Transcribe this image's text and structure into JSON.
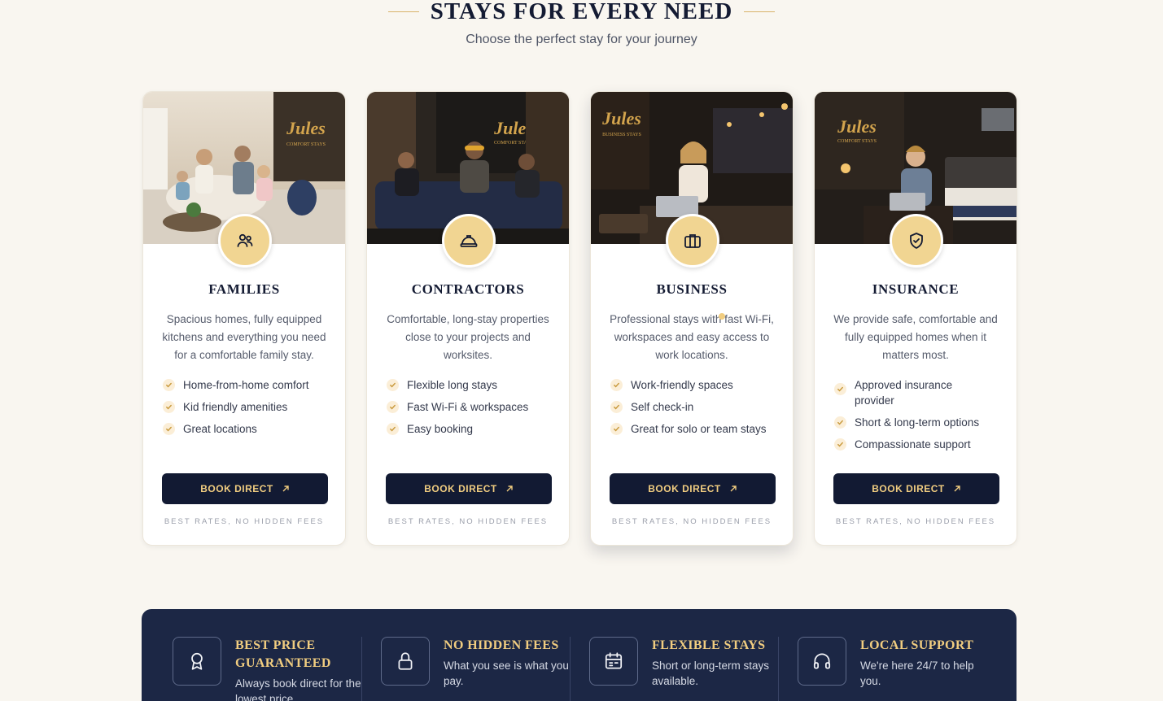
{
  "header": {
    "title": "STAYS FOR EVERY NEED",
    "subtitle": "Choose the perfect stay for your journey"
  },
  "cards": [
    {
      "icon": "family-icon",
      "title": "FAMILIES",
      "description": "Spacious homes, fully equipped kitchens and everything you need for a comfortable family stay.",
      "features": [
        "Home-from-home comfort",
        "Kid friendly amenities",
        "Great locations"
      ],
      "button": "BOOK DIRECT",
      "note": "BEST RATES, NO HIDDEN FEES"
    },
    {
      "icon": "hard-hat-icon",
      "title": "CONTRACTORS",
      "description": "Comfortable, long-stay properties close to your projects and worksites.",
      "features": [
        "Flexible long stays",
        "Fast Wi-Fi & workspaces",
        "Easy booking"
      ],
      "button": "BOOK DIRECT",
      "note": "BEST RATES, NO HIDDEN FEES"
    },
    {
      "icon": "briefcase-icon",
      "title": "BUSINESS",
      "description": "Professional stays with fast Wi-Fi, workspaces and easy access to work locations.",
      "features": [
        "Work-friendly spaces",
        "Self check-in",
        "Great for solo or team stays"
      ],
      "button": "BOOK DIRECT",
      "note": "BEST RATES, NO HIDDEN FEES"
    },
    {
      "icon": "shield-check-icon",
      "title": "INSURANCE",
      "description": "We provide safe, comfortable and fully equipped homes when it matters most.",
      "features": [
        "Approved insurance provider",
        "Short & long-term options",
        "Compassionate support"
      ],
      "button": "BOOK DIRECT",
      "note": "BEST RATES, NO HIDDEN FEES"
    }
  ],
  "perks": [
    {
      "icon": "award-icon",
      "title": "BEST PRICE GUARANTEED",
      "description": "Always book direct for the lowest price."
    },
    {
      "icon": "lock-icon",
      "title": "NO HIDDEN FEES",
      "description": "What you see is what you pay."
    },
    {
      "icon": "calendar-icon",
      "title": "FLEXIBLE STAYS",
      "description": "Short or long-term stays available."
    },
    {
      "icon": "headphones-icon",
      "title": "LOCAL SUPPORT",
      "description": "We're here 24/7 to help you."
    }
  ],
  "brand": {
    "logo_text": "Jules",
    "photo_signs": [
      "COMFORT STAYS",
      "COMFORT STAYS",
      "BUSINESS STAYS",
      "COMFORT STAYS"
    ]
  },
  "colors": {
    "navy": "#121a33",
    "gold": "#f1cd80",
    "badge": "#f1d592",
    "background": "#f9f6f0"
  }
}
